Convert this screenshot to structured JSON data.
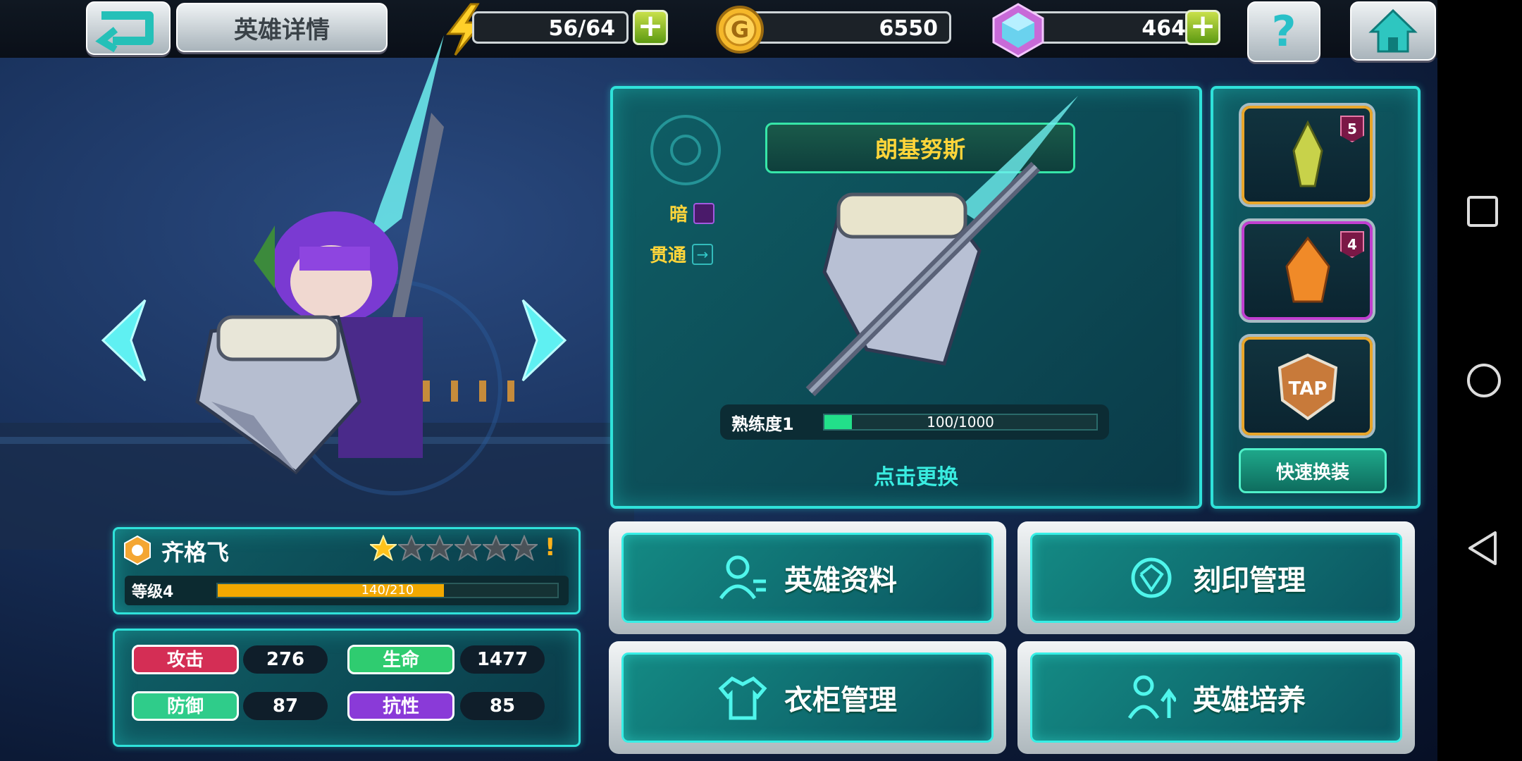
{
  "header": {
    "title": "英雄详情",
    "energy": "56/64",
    "gold": "6550",
    "gems": "464"
  },
  "weapon": {
    "name": "朗基努斯",
    "element": "暗",
    "trait": "贯通",
    "proficiency_label": "熟练度1",
    "proficiency_value": "100/1000",
    "proficiency_fraction": 0.1,
    "change_label": "点击更换"
  },
  "equipment": {
    "slots": [
      {
        "name": "wings-equip",
        "level": "5",
        "color": "orange"
      },
      {
        "name": "armor-equip",
        "level": "4",
        "color": "purple"
      },
      {
        "name": "tap-badge-equip",
        "level": "",
        "color": "orange"
      }
    ],
    "quick_equip_label": "快速换装"
  },
  "hero": {
    "name": "齐格飞",
    "level_label": "等级4",
    "exp_text": "140/210",
    "exp_fraction": 0.667,
    "stars_filled": 1,
    "stars_total": 6,
    "alert": "!",
    "stats": {
      "attack_label": "攻击",
      "attack": "276",
      "hp_label": "生命",
      "hp": "1477",
      "defense_label": "防御",
      "defense": "87",
      "resist_label": "抗性",
      "resist": "85"
    }
  },
  "actions": {
    "profile": "英雄资料",
    "engrave": "刻印管理",
    "wardrobe": "衣柜管理",
    "train": "英雄培养"
  },
  "colors": {
    "panel_border": "#2fe2da",
    "attack": "#d42e55",
    "hp": "#2fcc70",
    "defense": "#2fcc8a",
    "resist": "#8a3ad8",
    "exp_bar": "#f2a800"
  }
}
